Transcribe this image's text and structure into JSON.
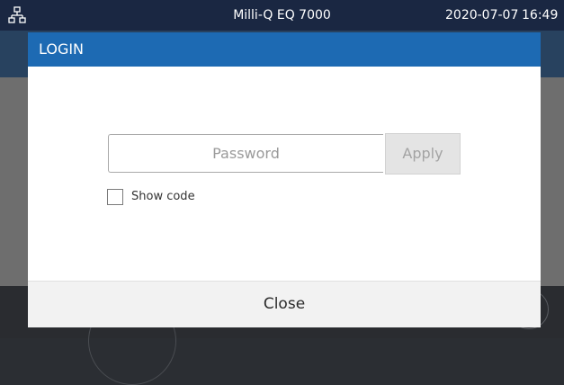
{
  "status_bar": {
    "network_icon": "network-icon",
    "device_name": "Milli-Q EQ 7000",
    "date": "2020-07-07",
    "time": "16:49"
  },
  "login_dialog": {
    "title": "LOGIN",
    "password_field": {
      "placeholder": "Password",
      "value": ""
    },
    "apply_label": "Apply",
    "show_code": {
      "label": "Show code",
      "checked": false
    },
    "close_label": "Close"
  },
  "colors": {
    "status_bar": "#1a2742",
    "dialog_header": "#1d6ab3",
    "apply_disabled": "#e4e4e4"
  }
}
